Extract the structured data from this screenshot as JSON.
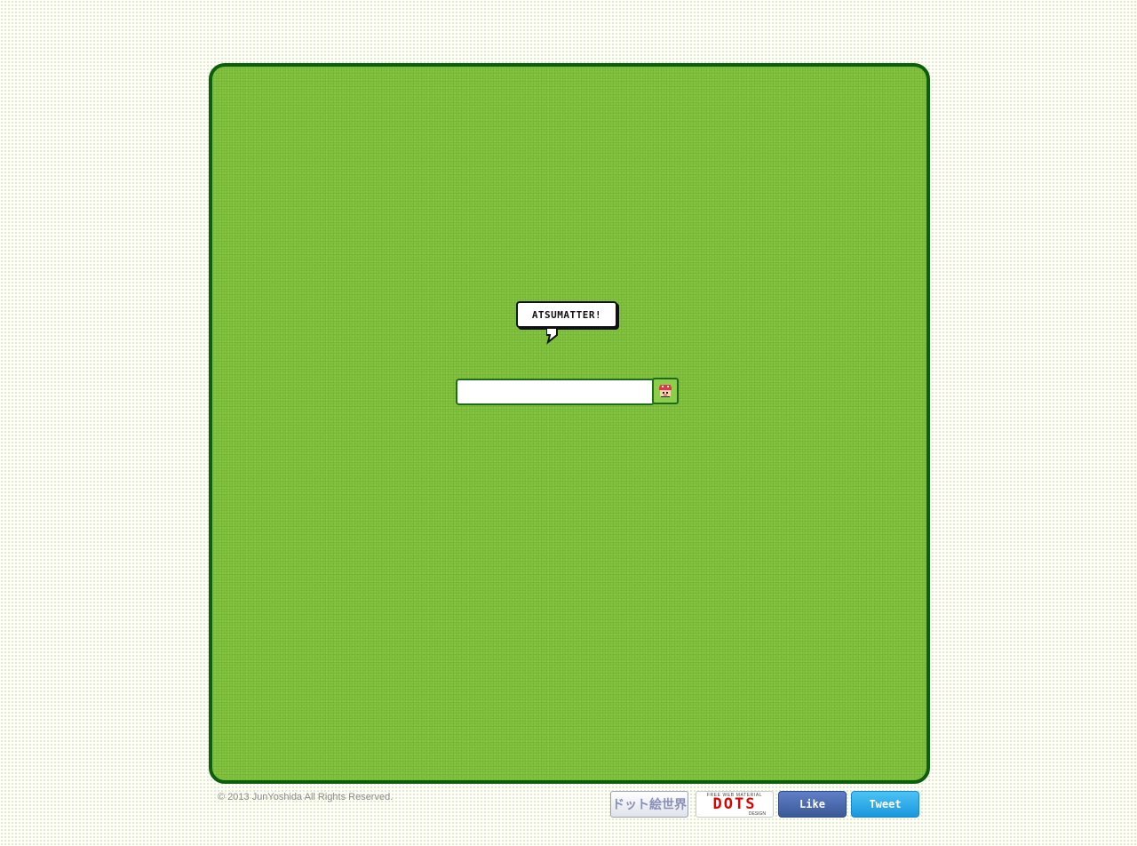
{
  "bubble": {
    "text": "ATSUMATTER!"
  },
  "search": {
    "value": "",
    "placeholder": ""
  },
  "footer": {
    "copyright": "© 2013 JunYoshida All Rights Reserved.",
    "badges": {
      "dot_world": "ドット絵世界",
      "dots_top": "FREE WEB MATERIAL",
      "dots_main": "DOTS",
      "dots_sub": "DESIGN"
    },
    "like_label": "Like",
    "tweet_label": "Tweet"
  },
  "colors": {
    "field_green": "#84c341",
    "field_border": "#0b5e0b",
    "like_blue": "#3b5998",
    "tweet_blue": "#1a97dd",
    "dots_red": "#e00000"
  },
  "icons": {
    "search_button": "mushroom-face-icon"
  }
}
